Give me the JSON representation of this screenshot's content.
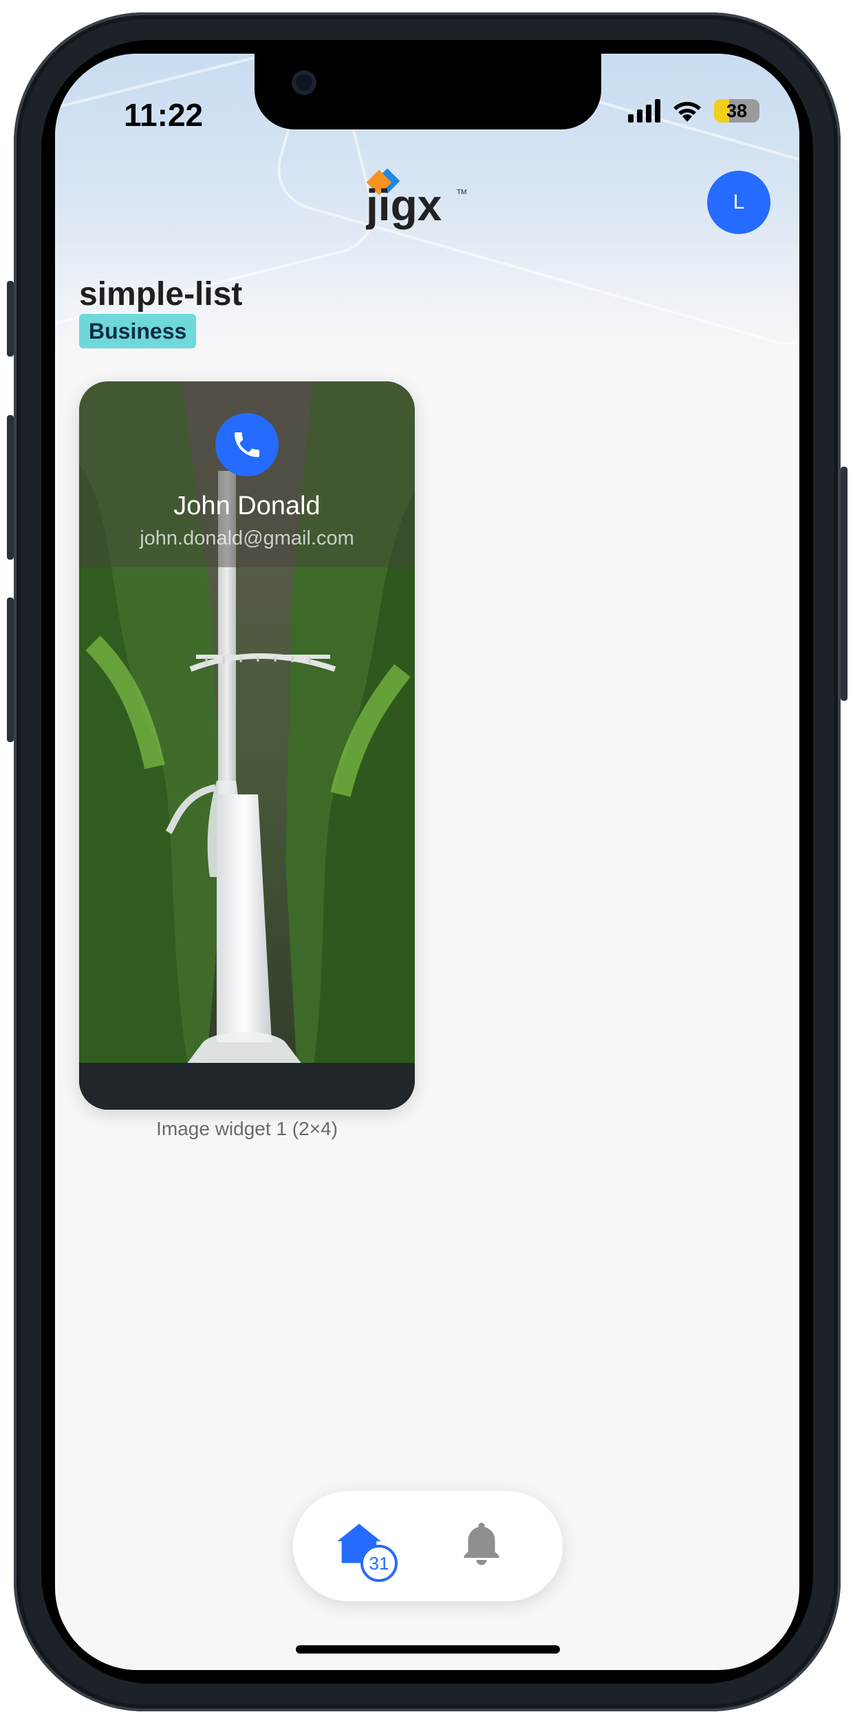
{
  "status_bar": {
    "time": "11:22",
    "battery": "38"
  },
  "header": {
    "logo_text": "jigx",
    "logo_tm": "TM",
    "avatar_initial": "L"
  },
  "page": {
    "title": "simple-list",
    "tag": "Business"
  },
  "widget": {
    "name": "John Donald",
    "email": "john.donald@gmail.com",
    "caption": "Image widget 1 (2×4)"
  },
  "tabbar": {
    "home_badge": "31"
  },
  "colors": {
    "accent": "#256bff",
    "tag_bg": "#6fd8da",
    "logo_orange": "#f7931e",
    "logo_blue": "#1e88e5"
  },
  "icons": [
    "phone-icon",
    "home-icon",
    "bell-icon",
    "signal-icon",
    "wifi-icon",
    "battery-icon"
  ]
}
